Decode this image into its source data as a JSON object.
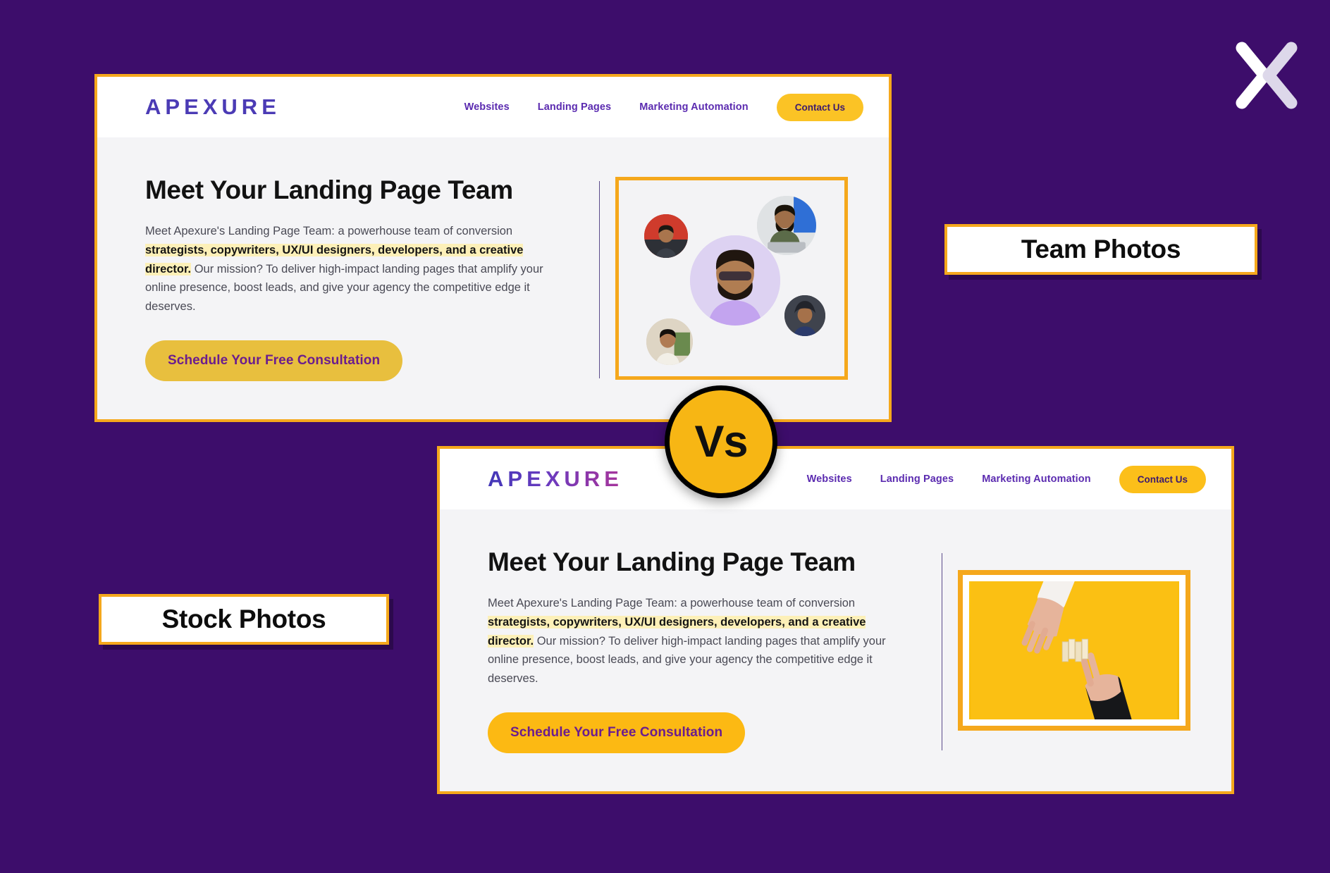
{
  "background_color": "#3d0d6b",
  "brand": {
    "logo_text": "APEXURE",
    "accent_yellow": "#f5a81c",
    "accent_purple": "#5b2bb0",
    "watermark_icon": "apexure-x-icon"
  },
  "vs_badge": {
    "label": "Vs",
    "color": "#f7b614"
  },
  "annotations": [
    {
      "id": "team",
      "label": "Team Photos"
    },
    {
      "id": "stock",
      "label": "Stock Photos"
    }
  ],
  "cards": [
    {
      "id": "team",
      "variant": "team-photos",
      "header": {
        "logo": "APEXURE",
        "nav": [
          {
            "label": "Websites"
          },
          {
            "label": "Landing Pages"
          },
          {
            "label": "Marketing Automation"
          }
        ],
        "cta": "Contact Us"
      },
      "content": {
        "headline": "Meet Your Landing Page Team",
        "paragraph_part1": "Meet Apexure's Landing Page Team: a powerhouse team of conversion ",
        "paragraph_highlight": "strategists, copywriters, UX/UI designers, developers, and a creative director.",
        "paragraph_part2": " Our mission? To deliver high-impact landing pages that amplify your online presence, boost leads, and give your agency the competitive edge it deserves.",
        "cta": "Schedule Your Free Consultation"
      },
      "media": {
        "type": "team-photo-collage",
        "alt": "Circular team member headshots arranged around a central portrait"
      }
    },
    {
      "id": "stock",
      "variant": "stock-photos",
      "header": {
        "logo": "APEXURE",
        "nav": [
          {
            "label": "Websites"
          },
          {
            "label": "Landing Pages"
          },
          {
            "label": "Marketing Automation"
          }
        ],
        "cta": "Contact Us"
      },
      "content": {
        "headline": "Meet Your Landing Page Team",
        "paragraph_part1": "Meet Apexure's Landing Page Team: a powerhouse team of conversion ",
        "paragraph_highlight": "strategists, copywriters, UX/UI designers, developers, and a creative director.",
        "paragraph_part2": " Our mission? To deliver high-impact landing pages that amplify your online presence, boost leads, and give your agency the competitive edge it deserves.",
        "cta": "Schedule Your Free Consultation"
      },
      "media": {
        "type": "stock-photo",
        "alt": "Two hands placing wooden blocks together on a yellow background"
      }
    }
  ]
}
